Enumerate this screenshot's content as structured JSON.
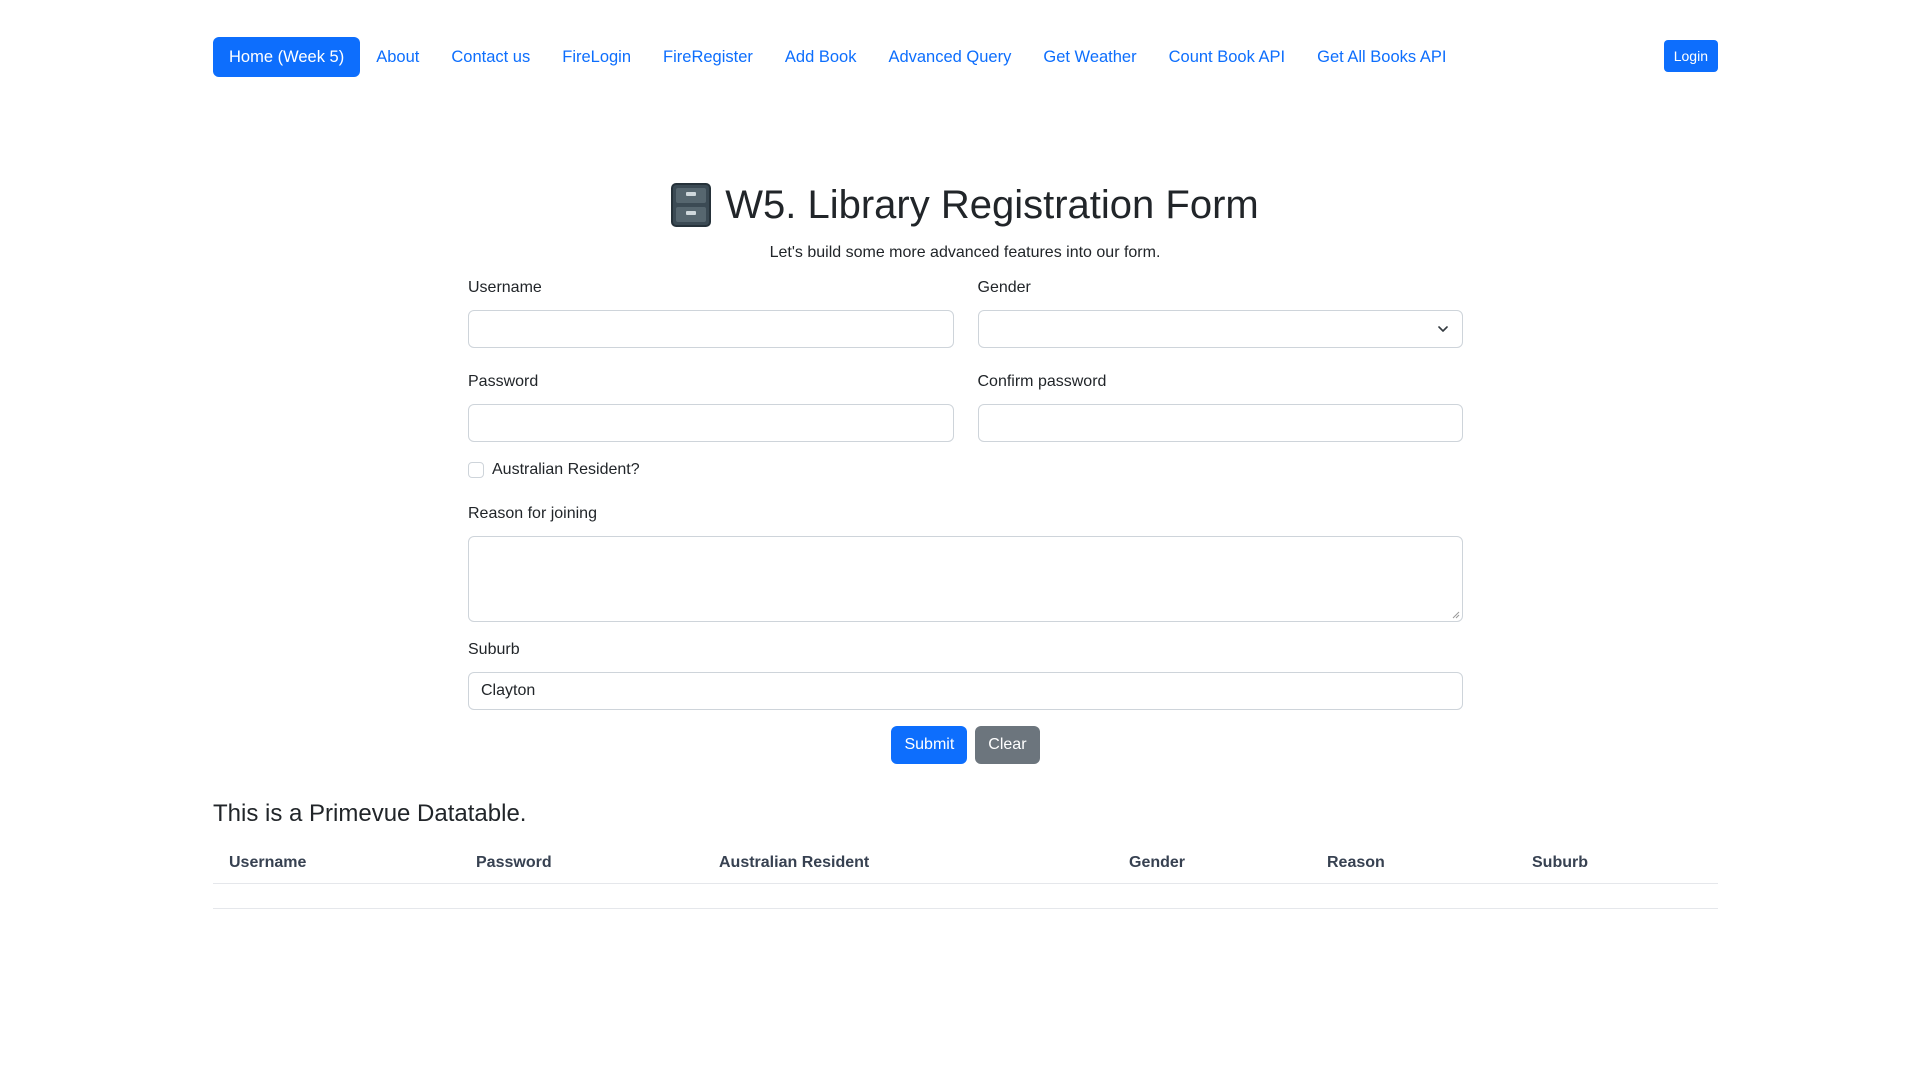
{
  "nav": {
    "items": [
      {
        "label": "Home (Week 5)",
        "active": true
      },
      {
        "label": "About"
      },
      {
        "label": "Contact us"
      },
      {
        "label": "FireLogin"
      },
      {
        "label": "FireRegister"
      },
      {
        "label": "Add Book"
      },
      {
        "label": "Advanced Query"
      },
      {
        "label": "Get Weather"
      },
      {
        "label": "Count Book API"
      },
      {
        "label": "Get All Books API"
      }
    ],
    "login_label": "Login"
  },
  "header": {
    "icon": "file-cabinet-icon",
    "title": "W5. Library Registration Form",
    "subtitle": "Let's build some more advanced features into our form."
  },
  "form": {
    "username_label": "Username",
    "username_value": "",
    "gender_label": "Gender",
    "gender_value": "",
    "password_label": "Password",
    "password_value": "",
    "confirm_password_label": "Confirm password",
    "confirm_password_value": "",
    "resident_label": "Australian Resident?",
    "resident_checked": false,
    "reason_label": "Reason for joining",
    "reason_value": "",
    "suburb_label": "Suburb",
    "suburb_value": "Clayton",
    "submit_label": "Submit",
    "clear_label": "Clear"
  },
  "table": {
    "heading": "This is a Primevue Datatable.",
    "columns": [
      "Username",
      "Password",
      "Australian Resident",
      "Gender",
      "Reason",
      "Suburb"
    ],
    "rows": []
  },
  "colors": {
    "primary": "#0d6efd",
    "secondary": "#6c757d",
    "text": "#212529"
  }
}
